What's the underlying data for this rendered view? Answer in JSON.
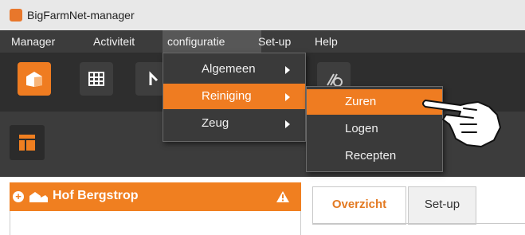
{
  "window": {
    "title": "BigFarmNet-manager"
  },
  "menubar": {
    "items": [
      {
        "label": "Manager"
      },
      {
        "label": "Activiteit"
      },
      {
        "label": "configuratie"
      },
      {
        "label": "Set-up"
      },
      {
        "label": "Help"
      }
    ]
  },
  "configuratie_menu": {
    "items": [
      {
        "label": "Algemeen"
      },
      {
        "label": "Reiniging"
      },
      {
        "label": "Zeug"
      }
    ]
  },
  "reiniging_submenu": {
    "items": [
      {
        "label": "Zuren"
      },
      {
        "label": "Logen"
      },
      {
        "label": "Recepten"
      }
    ]
  },
  "farm": {
    "name": "Hof Bergstrop",
    "plus": "+",
    "warning": "!"
  },
  "tabs": [
    {
      "label": "Overzicht",
      "active": true
    },
    {
      "label": "Set-up",
      "active": false
    }
  ],
  "colors": {
    "accent": "#ef7c21",
    "menubar": "#3c3c3c",
    "toolbar": "#2e2e2e"
  },
  "icons": [
    "app-icon",
    "barn-icon",
    "grid-icon",
    "arrow-icon",
    "feed-icon",
    "layout-icon",
    "farm-icon",
    "warning-icon",
    "pointing-hand-icon"
  ]
}
